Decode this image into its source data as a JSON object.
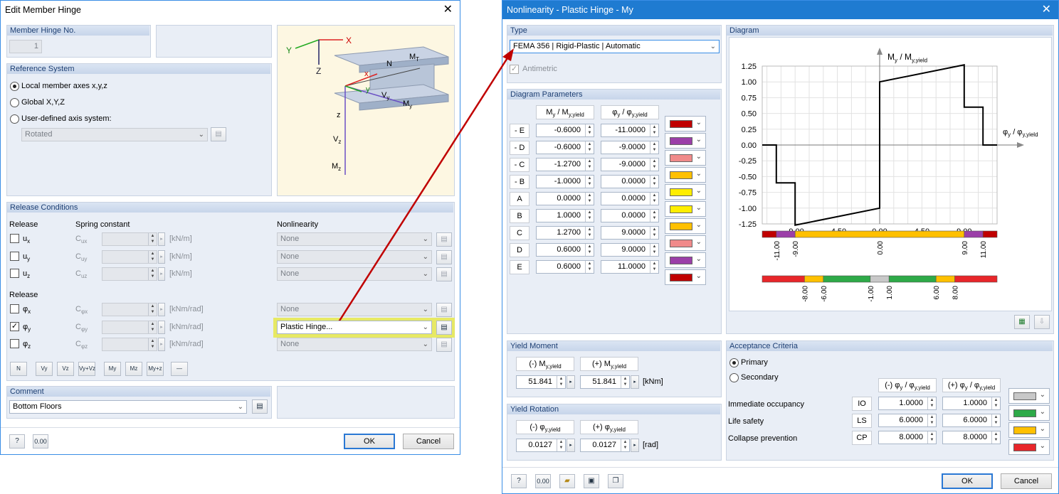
{
  "left": {
    "title": "Edit Member Hinge",
    "hinge_no_label": "Member Hinge No.",
    "hinge_no": "1",
    "ref_label": "Reference System",
    "ref_options": [
      "Local member axes x,y,z",
      "Global X,Y,Z",
      "User-defined axis system:"
    ],
    "rotated": "Rotated",
    "release_conditions": "Release Conditions",
    "release_label": "Release",
    "spring_label": "Spring constant",
    "nonlin_label": "Nonlinearity",
    "trans_rows": [
      {
        "sym": "u",
        "sub": "x",
        "c": "C",
        "csub": "ux",
        "unit": "[kN/m]",
        "nonlin": "None"
      },
      {
        "sym": "u",
        "sub": "y",
        "c": "C",
        "csub": "uy",
        "unit": "[kN/m]",
        "nonlin": "None"
      },
      {
        "sym": "u",
        "sub": "z",
        "c": "C",
        "csub": "uz",
        "unit": "[kN/m]",
        "nonlin": "None"
      }
    ],
    "rot_rows": [
      {
        "sym": "φ",
        "sub": "x",
        "c": "C",
        "csub": "φx",
        "unit": "[kNm/rad]",
        "nonlin": "None",
        "checked": false
      },
      {
        "sym": "φ",
        "sub": "y",
        "c": "C",
        "csub": "φy",
        "unit": "[kNm/rad]",
        "nonlin": "Plastic Hinge...",
        "checked": true
      },
      {
        "sym": "φ",
        "sub": "z",
        "c": "C",
        "csub": "φz",
        "unit": "[kNm/rad]",
        "nonlin": "None",
        "checked": false
      }
    ],
    "toolbar_icons": [
      "N",
      "Vy",
      "Vz",
      "Vy+Vz",
      "My",
      "Mz",
      "My+z",
      "—"
    ],
    "comment_label": "Comment",
    "comment": "Bottom Floors",
    "ok": "OK",
    "cancel": "Cancel",
    "figure_labels": {
      "X": "X",
      "Y": "Y",
      "Z": "Z",
      "x": "x",
      "y": "y",
      "z": "z",
      "N": "N",
      "MT": "M",
      "MT_sub": "T",
      "Vy": "V",
      "Vy_sub": "y",
      "My": "M",
      "My_sub": "y",
      "Vz": "V",
      "Vz_sub": "z",
      "Mz": "M",
      "Mz_sub": "z"
    }
  },
  "right": {
    "title": "Nonlinearity - Plastic Hinge - My",
    "type_label": "Type",
    "type_value": "FEMA 356 | Rigid-Plastic | Automatic",
    "antimetric": "Antimetric",
    "diag_params_label": "Diagram Parameters",
    "col1": "M",
    "col1_sub": "y",
    "col1b": " / M",
    "col1b_sub": "y,yield",
    "col2": "φ",
    "col2_sub": "y",
    "col2b": " / φ",
    "col2b_sub": "y,yield",
    "params": [
      {
        "pt": "- E",
        "m": "-0.6000",
        "phi": "-11.0000",
        "color": "#c00000"
      },
      {
        "pt": "- D",
        "m": "-0.6000",
        "phi": "-9.0000",
        "color": "#9b3fa8"
      },
      {
        "pt": "- C",
        "m": "-1.2700",
        "phi": "-9.0000",
        "color": "#f08a8a"
      },
      {
        "pt": "- B",
        "m": "-1.0000",
        "phi": "0.0000",
        "color": "#ffc000"
      },
      {
        "pt": "A",
        "m": "0.0000",
        "phi": "0.0000",
        "color": "#ffee00"
      },
      {
        "pt": "B",
        "m": "1.0000",
        "phi": "0.0000",
        "color": "#ffee00"
      },
      {
        "pt": "C",
        "m": "1.2700",
        "phi": "9.0000",
        "color": "#ffc000"
      },
      {
        "pt": "D",
        "m": "0.6000",
        "phi": "9.0000",
        "color": "#f08a8a"
      },
      {
        "pt": "E",
        "m": "0.6000",
        "phi": "11.0000",
        "color": "#9b3fa8"
      },
      {
        "pt": "",
        "m": "",
        "phi": "",
        "color": "#c00000"
      }
    ],
    "yield_moment_label": "Yield Moment",
    "ym_neg_hdr": "(-) M",
    "ym_pos_hdr": "(+) M",
    "ym_sub": "y,yield",
    "ym_neg": "51.841",
    "ym_pos": "51.841",
    "ym_unit": "[kNm]",
    "yield_rot_label": "Yield Rotation",
    "yr_neg_hdr": "(-) φ",
    "yr_pos_hdr": "(+) φ",
    "yr_sub": "y,yield",
    "yr_neg": "0.0127",
    "yr_pos": "0.0127",
    "yr_unit": "[rad]",
    "diagram_label": "Diagram",
    "y_axis_label": "M",
    "y_axis_sub": "y",
    "y_axis_label2": " / M",
    "y_axis_sub2": "y,yield",
    "x_axis_label": "φ",
    "x_axis_sub": "y",
    "x_axis_label2": " / φ",
    "x_axis_sub2": "y,yield",
    "acceptance_label": "Acceptance Criteria",
    "primary": "Primary",
    "secondary": "Secondary",
    "acc_hdr_neg": "(-) φ",
    "acc_hdr_pos": "(+) φ",
    "acc_sub": "y",
    "acc_sub2": " / φ",
    "acc_sub3": "y,yield",
    "criteria": [
      {
        "name": "Immediate occupancy",
        "code": "IO",
        "neg": "1.0000",
        "pos": "1.0000",
        "color": "#c8c8c8"
      },
      {
        "name": "Life safety",
        "code": "LS",
        "neg": "6.0000",
        "pos": "6.0000",
        "color": "#2eaa48"
      },
      {
        "name": "Collapse prevention",
        "code": "CP",
        "neg": "8.0000",
        "pos": "8.0000",
        "color": "#ffc000"
      },
      {
        "name": "",
        "code": "",
        "neg": "",
        "pos": "",
        "color": "#e8262a"
      }
    ],
    "ok": "OK",
    "cancel": "Cancel"
  },
  "chart_data": {
    "type": "line",
    "x": [
      -12.5,
      -11,
      -11,
      -9,
      -9,
      0,
      0,
      9,
      9,
      11,
      11,
      12.5
    ],
    "y": [
      0,
      0,
      -0.6,
      -0.6,
      -1.27,
      -1.0,
      1.0,
      1.27,
      0.6,
      0.6,
      0,
      0
    ],
    "xlim": [
      -12.5,
      12.5
    ],
    "ylim": [
      -1.25,
      1.25
    ],
    "y_ticks": [
      "1.25",
      "1.00",
      "0.75",
      "0.50",
      "0.25",
      "0.00",
      "-0.25",
      "-0.50",
      "-0.75",
      "-1.00",
      "-1.25"
    ],
    "y_tick_vals": [
      1.25,
      1.0,
      0.75,
      0.5,
      0.25,
      0.0,
      -0.25,
      -0.5,
      -0.75,
      -1.0,
      -1.25
    ],
    "x_ticks": [
      "-9.00",
      "-4.50",
      "0.00",
      "4.50",
      "9.00"
    ],
    "x_tick_vals": [
      -9,
      -4.5,
      0,
      4.5,
      9
    ],
    "bar1_ticks": [
      "-11.00",
      "-9.00",
      "0.00",
      "9.00",
      "11.00"
    ],
    "bar1_vals": [
      -11,
      -9,
      0,
      9,
      11
    ],
    "bar1_segments": [
      {
        "from": -12.5,
        "to": -11,
        "color": "#c00000"
      },
      {
        "from": -11,
        "to": -9,
        "color": "#9b3fa8"
      },
      {
        "from": -9,
        "to": 9,
        "color": "#ffc000"
      },
      {
        "from": 9,
        "to": 11,
        "color": "#9b3fa8"
      },
      {
        "from": 11,
        "to": 12.5,
        "color": "#c00000"
      }
    ],
    "bar2_ticks": [
      "-8.00",
      "-6.00",
      "-1.00",
      "1.00",
      "6.00",
      "8.00"
    ],
    "bar2_vals": [
      -8,
      -6,
      -1,
      1,
      6,
      8
    ],
    "bar2_segments": [
      {
        "from": -12.5,
        "to": -8,
        "color": "#e8262a"
      },
      {
        "from": -8,
        "to": -6,
        "color": "#ffc000"
      },
      {
        "from": -6,
        "to": -1,
        "color": "#2eaa48"
      },
      {
        "from": -1,
        "to": 1,
        "color": "#c8c8c8"
      },
      {
        "from": 1,
        "to": 6,
        "color": "#2eaa48"
      },
      {
        "from": 6,
        "to": 8,
        "color": "#ffc000"
      },
      {
        "from": 8,
        "to": 12.5,
        "color": "#e8262a"
      }
    ],
    "grid": true
  }
}
